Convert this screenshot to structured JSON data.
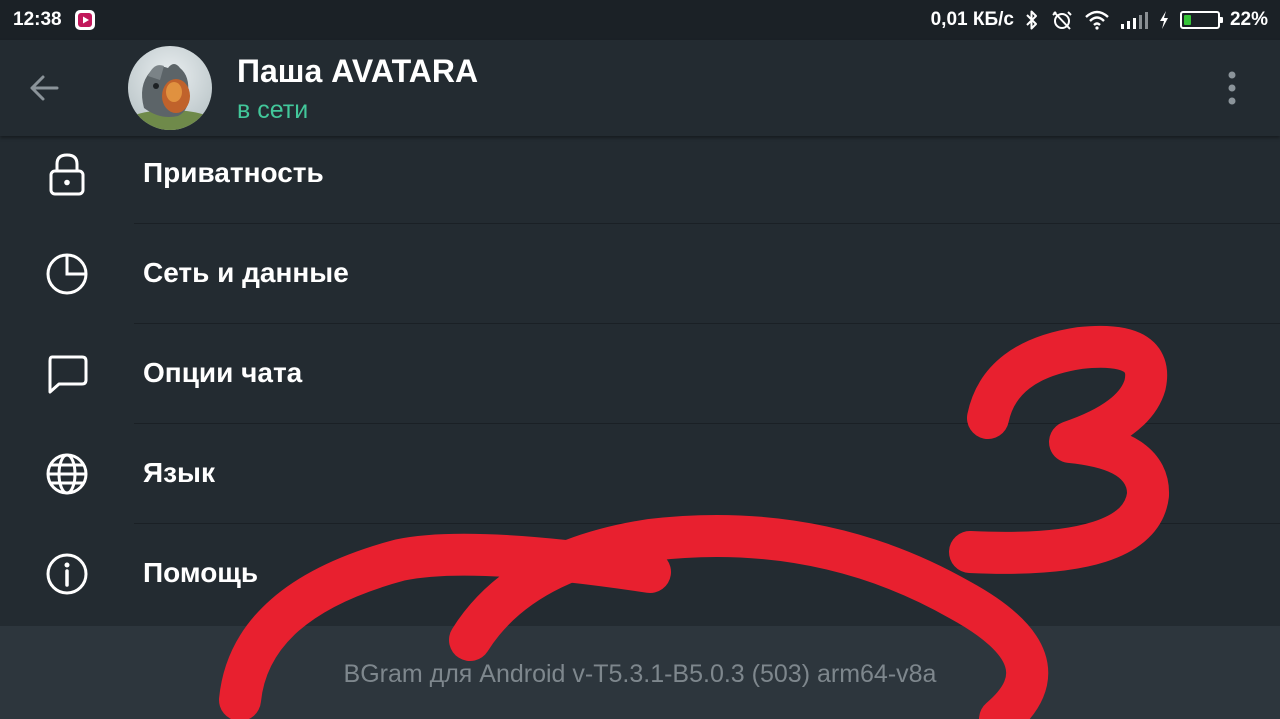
{
  "status_bar": {
    "time": "12:38",
    "network_speed": "0,01 КБ/с",
    "battery_percent": "22%",
    "battery_level": 0.22,
    "battery_color": "#35c437",
    "icons": [
      "app-notification-icon",
      "bluetooth-icon",
      "alarm-off-icon",
      "wifi-icon",
      "signal-icon",
      "charging-icon",
      "battery-icon"
    ]
  },
  "header": {
    "back_icon": "arrow-left-icon",
    "name": "Паша AVATARA",
    "status": "в сети",
    "status_color": "#42c79a",
    "menu_icon": "more-vertical-icon"
  },
  "settings": {
    "items": [
      {
        "label": "Приватность",
        "icon": "lock-icon"
      },
      {
        "label": "Сеть и данные",
        "icon": "pie-chart-icon"
      },
      {
        "label": "Опции чата",
        "icon": "chat-bubble-icon"
      },
      {
        "label": "Язык",
        "icon": "globe-icon"
      },
      {
        "label": "Помощь",
        "icon": "info-icon"
      }
    ]
  },
  "footer": {
    "version": "BGram для Android v-T5.3.1-B5.0.3 (503) arm64-v8a"
  },
  "annotation": {
    "color": "#e8202f"
  }
}
